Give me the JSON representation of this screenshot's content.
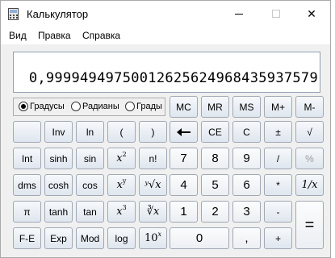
{
  "window": {
    "title": "Калькулятор",
    "controls": {
      "minimize": "—",
      "maximize": "☐",
      "close": "✕"
    }
  },
  "menu": [
    "Вид",
    "Правка",
    "Справка"
  ],
  "display": {
    "value": "0,999949497500126256249684359375 79"
  },
  "mode": {
    "options": [
      "Градусы",
      "Радианы",
      "Грады"
    ],
    "selected": "Градусы"
  },
  "keys": {
    "memory": [
      "MC",
      "MR",
      "MS",
      "M+",
      "M-"
    ],
    "row1": [
      "",
      "Inv",
      "ln",
      "(",
      ")",
      "",
      "CE",
      "C",
      "±",
      "√"
    ],
    "row2": [
      "Int",
      "sinh",
      "sin",
      "x",
      "n!",
      "7",
      "8",
      "9",
      "/",
      "%"
    ],
    "row3": [
      "dms",
      "cosh",
      "cos",
      "x",
      "x",
      "4",
      "5",
      "6",
      "*",
      "1/x"
    ],
    "row4": [
      "π",
      "tanh",
      "tan",
      "x",
      "x",
      "1",
      "2",
      "3",
      "-",
      "="
    ],
    "row5": [
      "F-E",
      "Exp",
      "Mod",
      "log",
      "10",
      "0",
      ",",
      "+"
    ],
    "labels": {
      "sq_exp": "2",
      "cube_exp": "3",
      "pow_exp": "y",
      "root3": "∛x",
      "rooty": "∛x",
      "ten_exp": "x"
    }
  },
  "icons": {
    "app": "calculator-icon",
    "backspace": "backspace-arrow-icon"
  }
}
